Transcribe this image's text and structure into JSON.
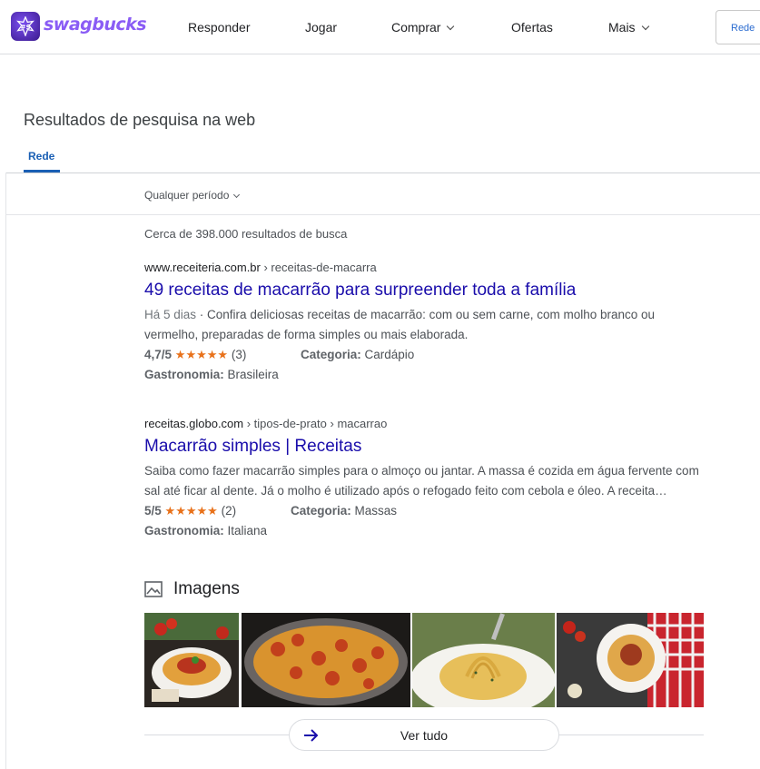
{
  "nav": {
    "logo_text": "swagbucks",
    "items": [
      {
        "label": "Responder"
      },
      {
        "label": "Jogar"
      },
      {
        "label": "Comprar"
      },
      {
        "label": "Ofertas"
      },
      {
        "label": "Mais"
      }
    ],
    "right_button": "Rede"
  },
  "page": {
    "title": "Resultados de pesquisa na web",
    "tab": "Rede",
    "filter": "Qualquer período",
    "count": "Cerca de 398.000 resultados de busca"
  },
  "results": [
    {
      "domain": "www.receiteria.com.br",
      "path": " › receitas-de-macarra",
      "title": "49 receitas de macarrão para surpreender toda a família",
      "date": "Há 5 dias",
      "snippet": " · Confira deliciosas receitas de macarrão: com ou sem carne, com molho branco ou vermelho, preparadas de forma simples ou mais elaborada.",
      "rating": "4,7/5",
      "stars": "★★★★★",
      "reviews": "(3)",
      "category_label": "Categoria:",
      "category": "Cardápio",
      "cuisine_label": "Gastronomia:",
      "cuisine": "Brasileira"
    },
    {
      "domain": "receitas.globo.com",
      "path": " › tipos-de-prato › macarrao",
      "title": "Macarrão simples | Receitas",
      "snippet": "Saiba como fazer macarrão simples para o almoço ou jantar. A massa é cozida em água fervente com sal até ficar al dente. Já o molho é utilizado após o refogado feito com cebola e óleo. A receita…",
      "rating": "5/5",
      "stars": "★★★★★",
      "reviews": "(2)",
      "category_label": "Categoria:",
      "category": "Massas",
      "cuisine_label": "Gastronomia:",
      "cuisine": "Italiana"
    }
  ],
  "images": {
    "heading": "Imagens",
    "see_all": "Ver tudo"
  },
  "colors": {
    "link": "#1a0dab",
    "tab_accent": "#1a5fb4",
    "star": "#e8711a",
    "brand": "#8a5cf5"
  }
}
